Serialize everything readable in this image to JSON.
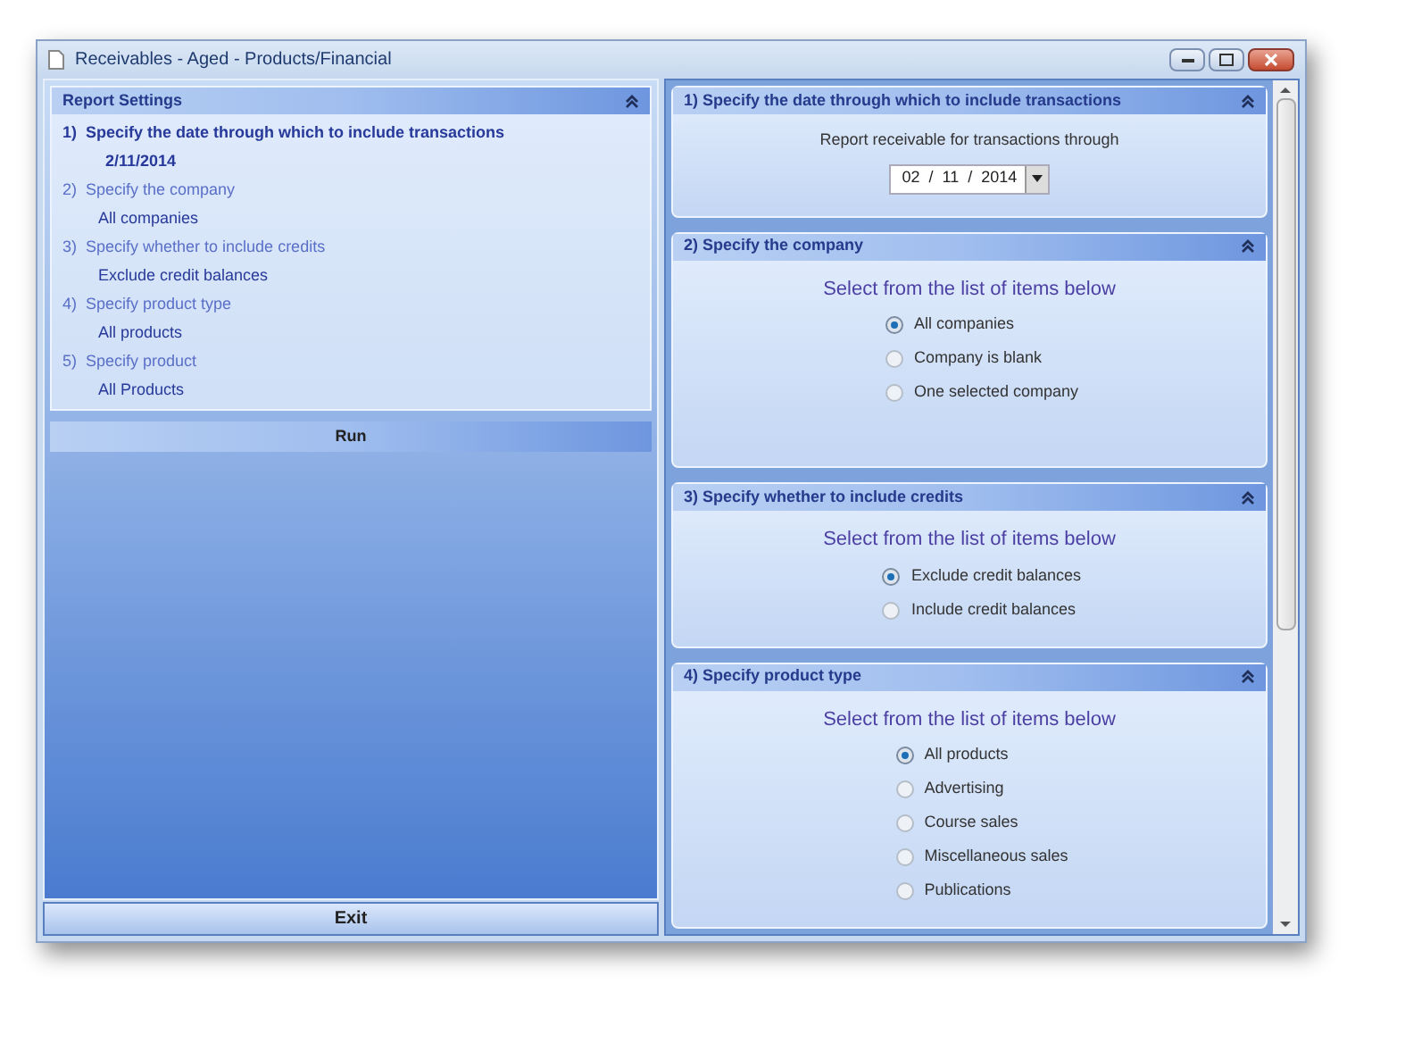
{
  "window": {
    "title": "Receivables - Aged - Products/Financial"
  },
  "report_settings": {
    "title": "Report Settings",
    "items": [
      {
        "label": "1)  Specify the date through which to include transactions",
        "value": "2/11/2014",
        "selected": true
      },
      {
        "label": "2)  Specify the company",
        "value": "All companies",
        "selected": false
      },
      {
        "label": "3)  Specify whether to include credits",
        "value": "Exclude credit balances",
        "selected": false
      },
      {
        "label": "4)  Specify product type",
        "value": "All products",
        "selected": false
      },
      {
        "label": "5)  Specify product",
        "value": "All Products",
        "selected": false
      }
    ]
  },
  "run_button": "Run",
  "exit_button": "Exit",
  "sections": [
    {
      "kind": "date",
      "title": "1)  Specify the date through which to include transactions",
      "prompt": "Report receivable for transactions through",
      "date": "02  /  11  /  2014"
    },
    {
      "kind": "radio",
      "title": "2)  Specify the company",
      "prompt": "Select from the list of items below",
      "options": [
        {
          "label": "All companies",
          "selected": true
        },
        {
          "label": "Company is blank",
          "selected": false
        },
        {
          "label": "One selected company",
          "selected": false
        }
      ]
    },
    {
      "kind": "radio",
      "title": "3)  Specify whether to include credits",
      "prompt": "Select from the list of items below",
      "options": [
        {
          "label": "Exclude credit balances",
          "selected": true
        },
        {
          "label": "Include credit balances",
          "selected": false
        }
      ]
    },
    {
      "kind": "radio",
      "title": "4)  Specify product type",
      "prompt": "Select from the list of items below",
      "options": [
        {
          "label": "All products",
          "selected": true
        },
        {
          "label": "Advertising",
          "selected": false
        },
        {
          "label": "Course sales",
          "selected": false
        },
        {
          "label": "Miscellaneous sales",
          "selected": false
        },
        {
          "label": "Publications",
          "selected": false
        }
      ]
    }
  ]
}
